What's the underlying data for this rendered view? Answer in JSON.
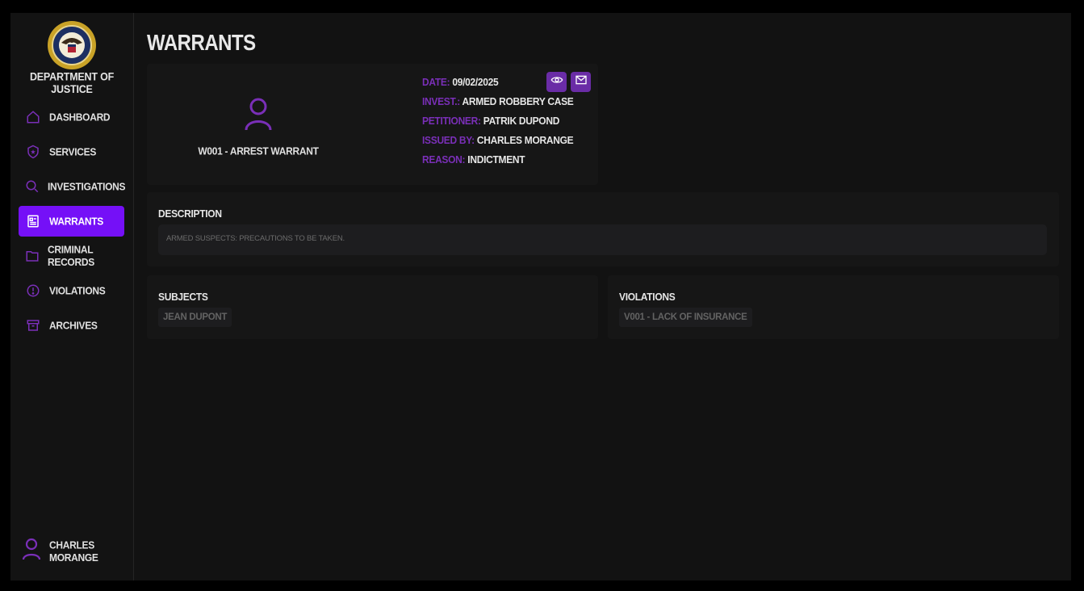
{
  "sidebar": {
    "org_name": "DEPARTMENT OF JUSTICE",
    "items": [
      {
        "label": "DASHBOARD",
        "icon": "home-icon"
      },
      {
        "label": "SERVICES",
        "icon": "shield-star-icon"
      },
      {
        "label": "INVESTIGATIONS",
        "icon": "search-icon"
      },
      {
        "label": "WARRANTS",
        "icon": "document-icon",
        "active": true
      },
      {
        "label": "CRIMINAL RECORDS",
        "icon": "folder-icon"
      },
      {
        "label": "VIOLATIONS",
        "icon": "alert-circle-icon"
      },
      {
        "label": "ARCHIVES",
        "icon": "archive-box-icon"
      }
    ],
    "user": {
      "name": "CHARLES MORANGE",
      "icon": "user-icon"
    }
  },
  "page": {
    "title": "WARRANTS"
  },
  "warrant": {
    "title": "W001 - ARREST WARRANT",
    "fields": [
      {
        "key": "DATE:",
        "value": "09/02/2025"
      },
      {
        "key": "INVEST.:",
        "value": "ARMED ROBBERY CASE"
      },
      {
        "key": "PETITIONER:",
        "value": "PATRIK DUPOND"
      },
      {
        "key": "ISSUED BY:",
        "value": "CHARLES MORANGE"
      },
      {
        "key": "REASON:",
        "value": "INDICTMENT"
      }
    ]
  },
  "description": {
    "title": "DESCRIPTION",
    "text": "ARMED SUSPECTS: PRECAUTIONS TO BE TAKEN."
  },
  "subjects": {
    "title": "SUBJECTS",
    "items": [
      "JEAN DUPONT"
    ]
  },
  "violations": {
    "title": "VIOLATIONS",
    "items": [
      "V001 - LACK OF INSURANCE"
    ]
  },
  "colors": {
    "accent": "#7510f7",
    "label_purple": "#7a2fb8",
    "button_purple": "#6a2ca6"
  }
}
